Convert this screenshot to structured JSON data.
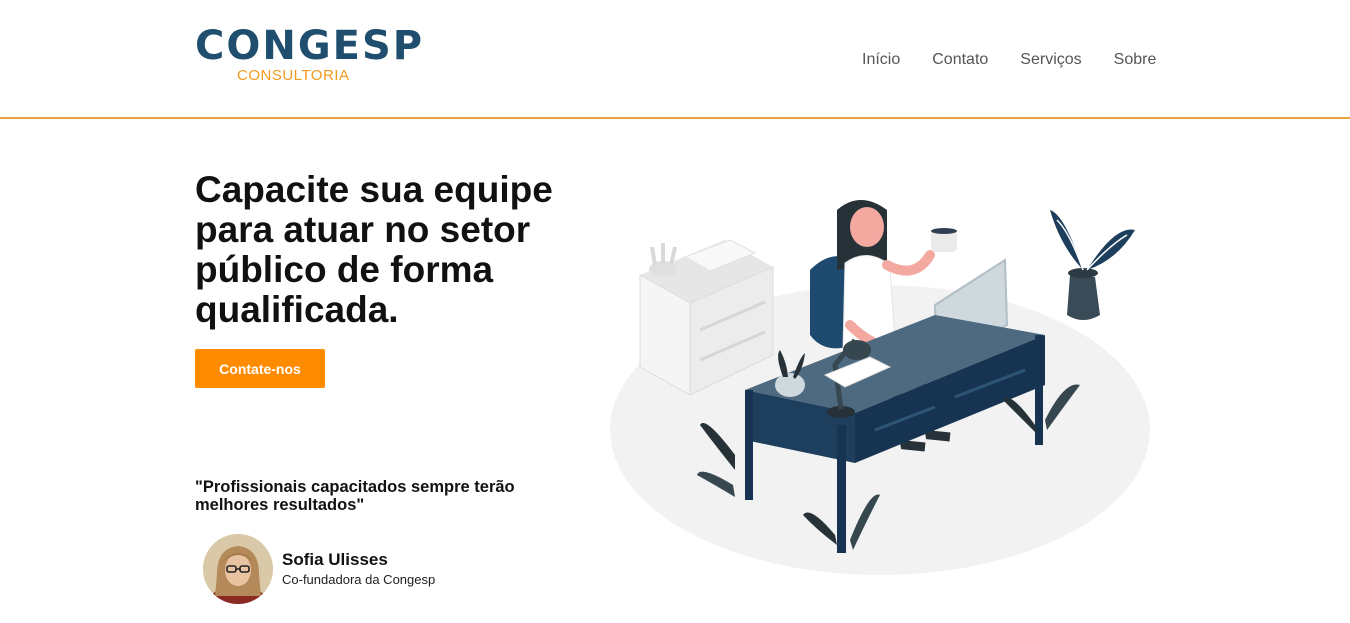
{
  "brand": {
    "name": "CONGESP",
    "subtitle": "CONSULTORIA",
    "primary_color": "#1f4e6e",
    "accent_color": "#f29a1b"
  },
  "nav": {
    "items": [
      {
        "label": "Início"
      },
      {
        "label": "Contato"
      },
      {
        "label": "Serviços"
      },
      {
        "label": "Sobre"
      }
    ]
  },
  "hero": {
    "title": "Capacite sua equipe para atuar no setor público de forma qualificada.",
    "cta_label": "Contate-nos",
    "cta_color": "#ff8c00",
    "illustration_icon": "woman-at-desk-illustration"
  },
  "testimonial": {
    "quote": "\"Profissionais capacitados sempre terão melhores resultados\"",
    "author_name": "Sofia Ulisses",
    "author_role": "Co-fundadora da Congesp"
  }
}
